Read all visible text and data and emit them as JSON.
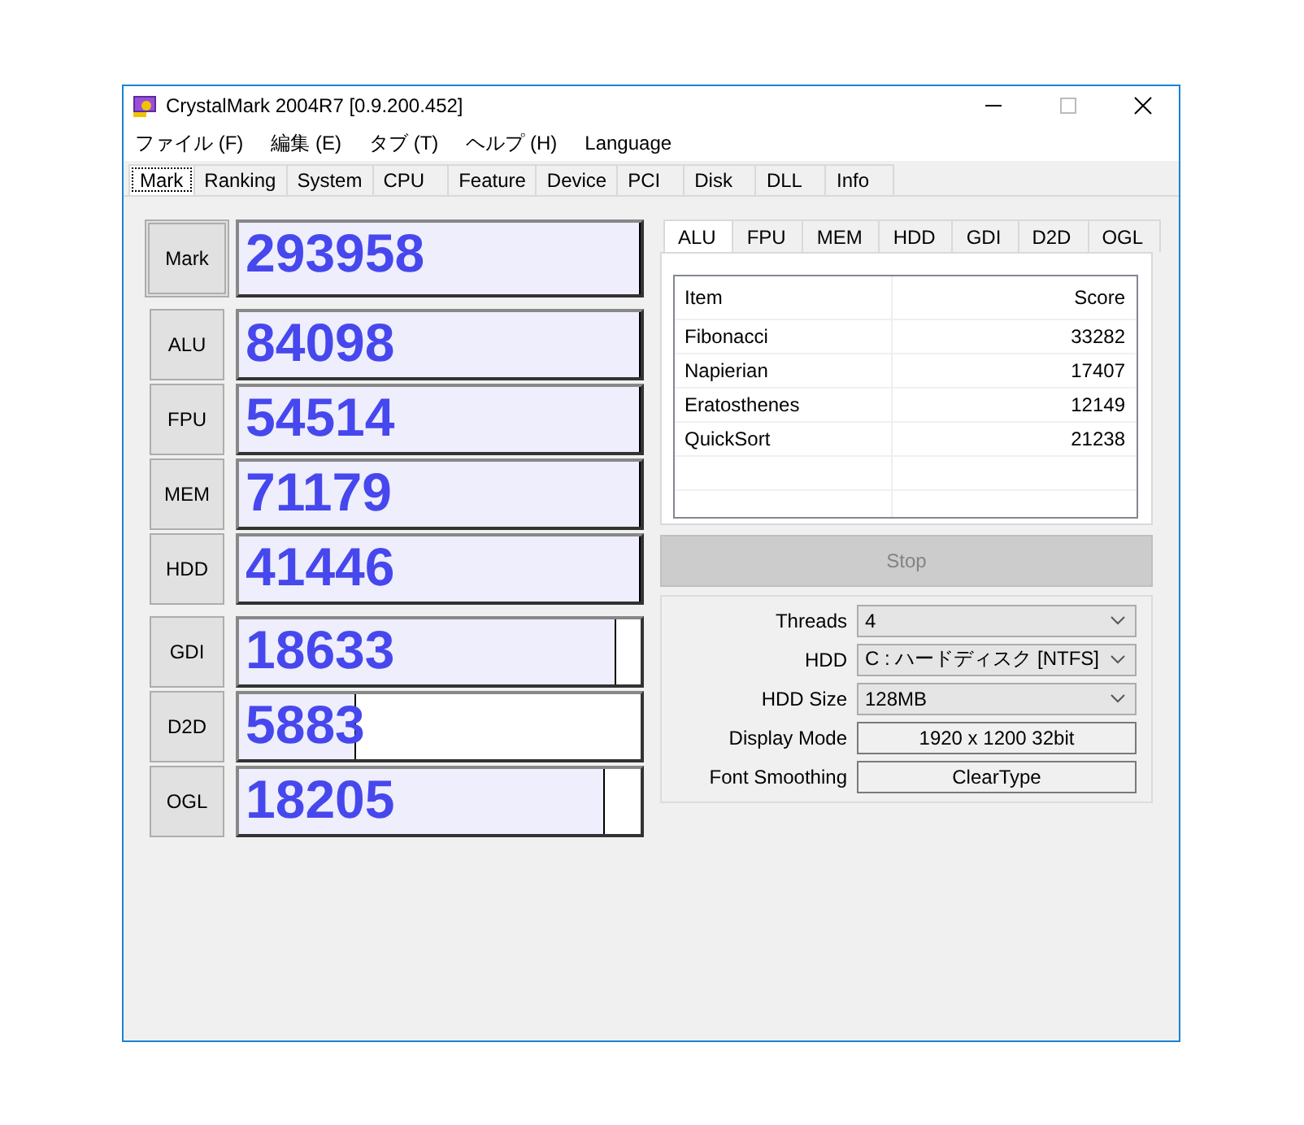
{
  "window": {
    "title": "CrystalMark 2004R7 [0.9.200.452]"
  },
  "menu": [
    "ファイル (F)",
    "編集 (E)",
    "タブ (T)",
    "ヘルプ (H)",
    "Language"
  ],
  "tabs": [
    {
      "label": "Mark",
      "selected": true
    },
    {
      "label": "Ranking",
      "selected": false
    },
    {
      "label": "System",
      "selected": false
    },
    {
      "label": "CPU",
      "selected": false
    },
    {
      "label": "Feature",
      "selected": false
    },
    {
      "label": "Device",
      "selected": false
    },
    {
      "label": "PCI",
      "selected": false
    },
    {
      "label": "Disk",
      "selected": false
    },
    {
      "label": "DLL",
      "selected": false
    },
    {
      "label": "Info",
      "selected": false
    }
  ],
  "score_groups": [
    [
      {
        "label": "Mark",
        "score": "293958",
        "level": 1,
        "kind": "total"
      }
    ],
    [
      {
        "label": "ALU",
        "score": "84098",
        "level": 1,
        "kind": "part"
      },
      {
        "label": "FPU",
        "score": "54514",
        "level": 1,
        "kind": "part"
      },
      {
        "label": "MEM",
        "score": "71179",
        "level": 1,
        "kind": "part"
      },
      {
        "label": "HDD",
        "score": "41446",
        "level": 1,
        "kind": "part"
      }
    ],
    [
      {
        "label": "GDI",
        "score": "18633",
        "level": 0.94,
        "kind": "part"
      },
      {
        "label": "D2D",
        "score": "5883",
        "level": 0.29,
        "kind": "part"
      },
      {
        "label": "OGL",
        "score": "18205",
        "level": 0.91,
        "kind": "part"
      }
    ]
  ],
  "detail_tabs": [
    {
      "label": "ALU",
      "selected": true
    },
    {
      "label": "FPU",
      "selected": false
    },
    {
      "label": "MEM",
      "selected": false
    },
    {
      "label": "HDD",
      "selected": false
    },
    {
      "label": "GDI",
      "selected": false
    },
    {
      "label": "D2D",
      "selected": false
    },
    {
      "label": "OGL",
      "selected": false
    }
  ],
  "table": {
    "columns": [
      "Item",
      "Score"
    ],
    "rows": [
      [
        "Fibonacci",
        "33282"
      ],
      [
        "Napierian",
        "17407"
      ],
      [
        "Eratosthenes",
        "12149"
      ],
      [
        "QuickSort",
        "21238"
      ]
    ]
  },
  "stop_button": {
    "label": "Stop",
    "disabled": true
  },
  "settings": [
    {
      "label": "Threads",
      "value": "4",
      "kind": "select"
    },
    {
      "label": "HDD",
      "value": "C : ハードディスク [NTFS]",
      "kind": "select"
    },
    {
      "label": "HDD Size",
      "value": "128MB",
      "kind": "select"
    },
    {
      "label": "Display Mode",
      "value": "1920 x 1200 32bit",
      "kind": "readonly"
    },
    {
      "label": "Font Smoothing",
      "value": "ClearType",
      "kind": "readonly"
    }
  ]
}
